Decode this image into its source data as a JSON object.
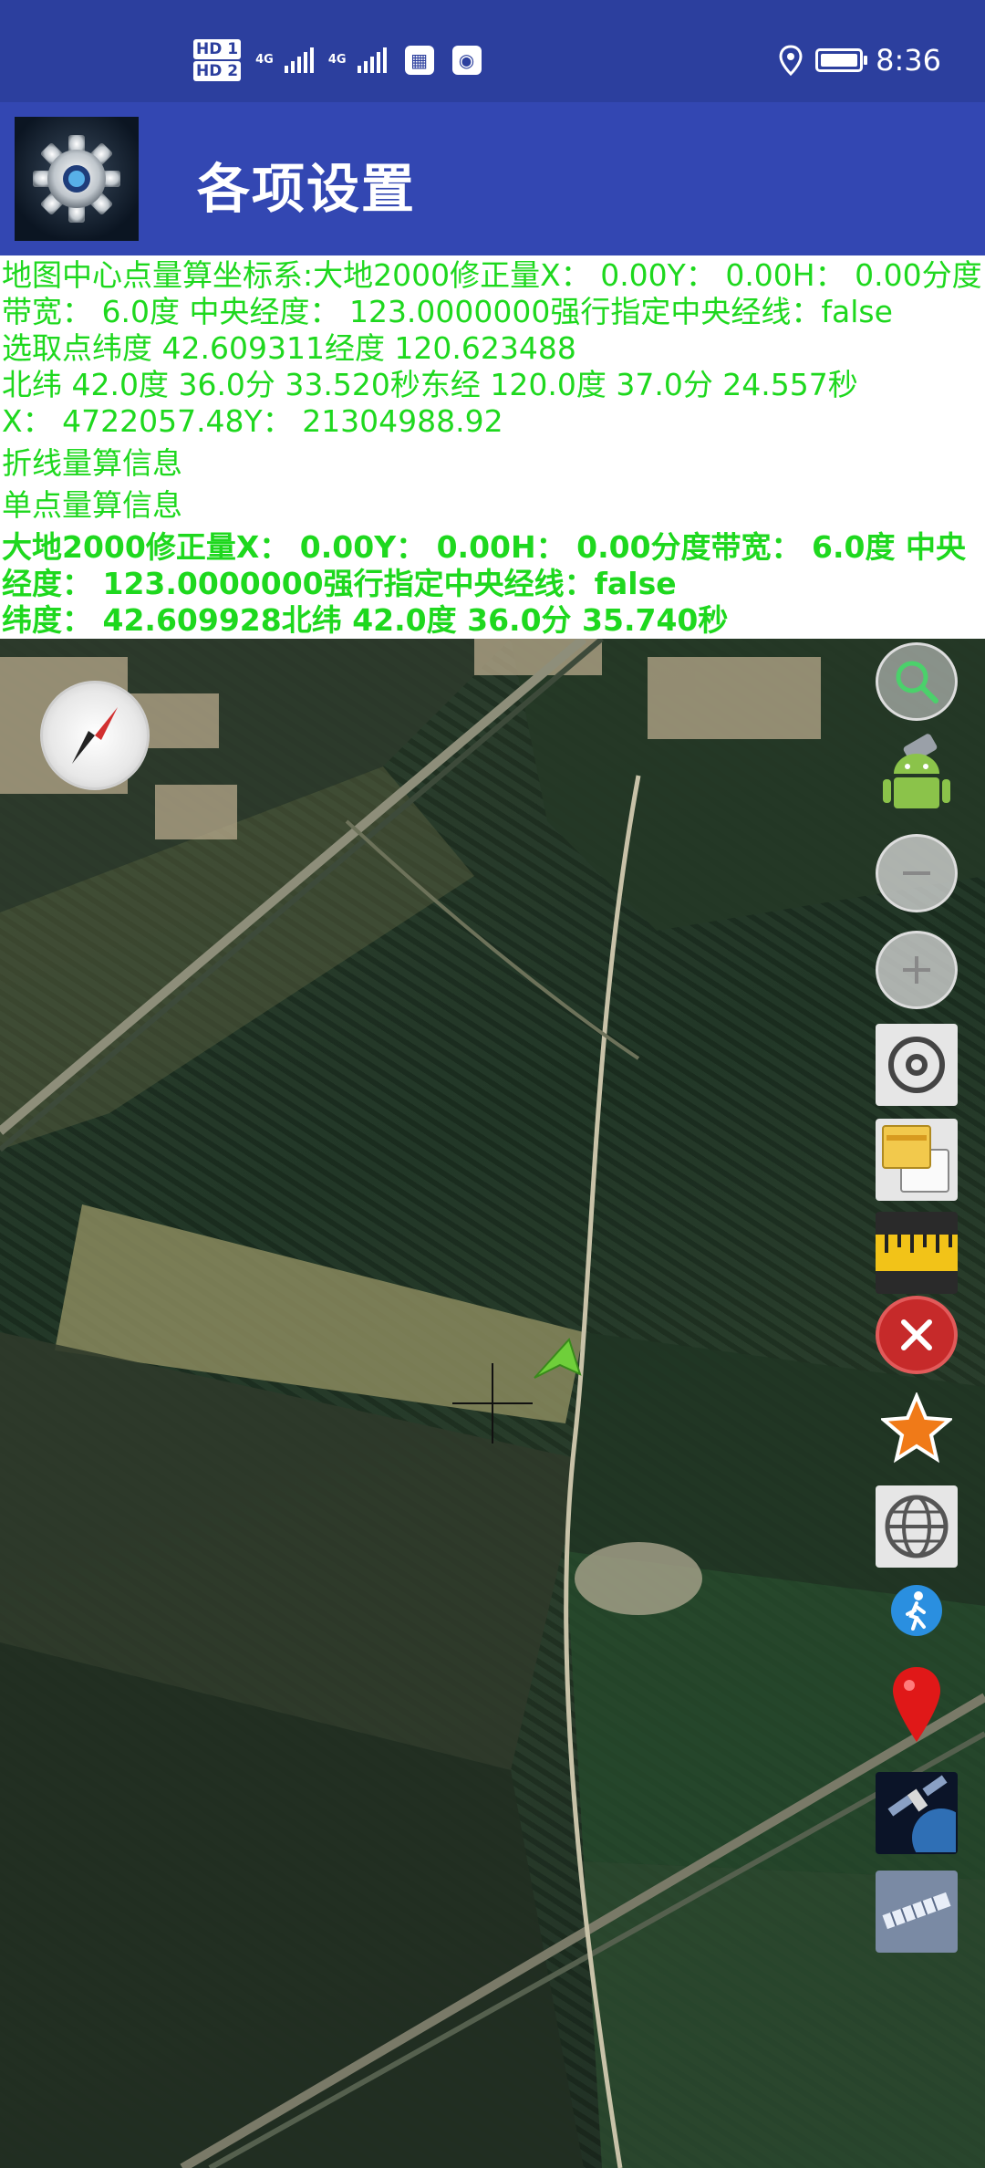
{
  "status_bar": {
    "hd1": "HD 1",
    "hd2": "HD 2",
    "net1": "4G",
    "net2": "4G",
    "time": "8:36"
  },
  "app_bar": {
    "title": "各项设置"
  },
  "info": {
    "line1": "地图中心点量算坐标系:大地2000修正量X： 0.00Y： 0.00H： 0.00分度带宽： 6.0度 中央经度： 123.0000000强行指定中央经线：false",
    "line2": "选取点纬度 42.609311经度 120.623488",
    "line3": "北纬 42.0度 36.0分 33.520秒东经 120.0度 37.0分 24.557秒",
    "line4": "X： 4722057.48Y： 21304988.92",
    "line5": "折线量算信息",
    "line6": "单点量算信息",
    "line7": "大地2000修正量X： 0.00Y： 0.00H： 0.00分度带宽： 6.0度 中央经度： 123.0000000强行指定中央经线：false",
    "line8": "纬度： 42.609928北纬 42.0度 36.0分 35.740秒"
  },
  "colors": {
    "status_bar": "#2c3f9e",
    "app_bar": "#3347b2",
    "info_text": "#1ed81e",
    "close_button": "#c62a2a"
  },
  "toolbar_icons": [
    "search-icon",
    "android-icon",
    "zoom-out-icon",
    "zoom-in-icon",
    "locate-icon",
    "layers-icon",
    "ruler-icon",
    "close-icon",
    "star-icon",
    "globe-icon",
    "walk-icon",
    "pin-icon",
    "satellite-icon",
    "satellite-2-icon"
  ]
}
